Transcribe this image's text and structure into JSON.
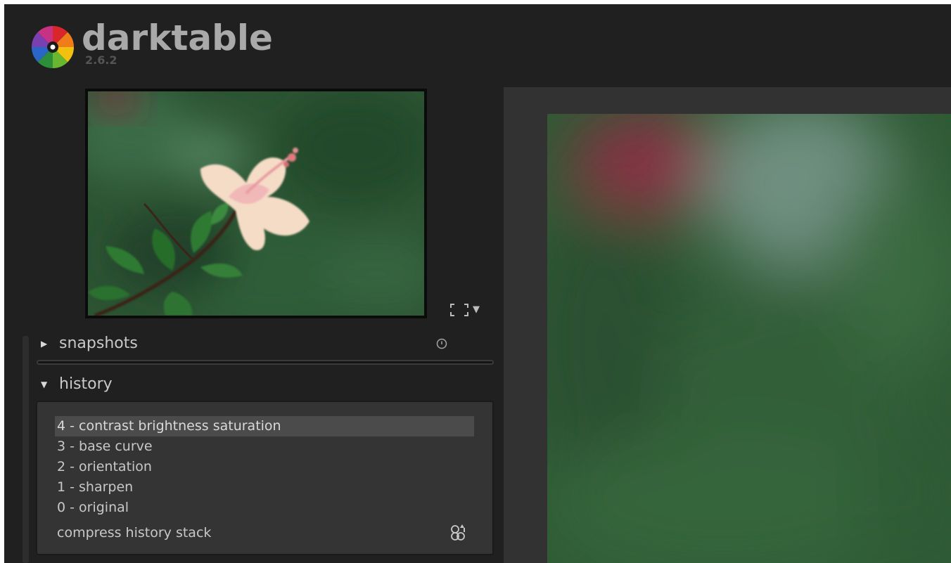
{
  "header": {
    "app_name": "darktable",
    "version": "2.6.2"
  },
  "navigation": {
    "thumbnail_icon": "hibiscus-flower-image",
    "fit_icon": "fit-to-screen-icon",
    "zoom_caret": "▼"
  },
  "snapshots": {
    "title": "snapshots",
    "collapse_icon": "triangle-right-icon",
    "reset_icon": "reset-circle-icon"
  },
  "history": {
    "title": "history",
    "collapse_icon": "triangle-down-icon",
    "items": [
      "4 - contrast brightness saturation",
      "3 - base curve",
      "2 - orientation",
      "1 - sharpen",
      "0 - original"
    ],
    "selected_index": 0,
    "compress_label": "compress history stack",
    "compress_icon": "create-style-icon"
  },
  "colors": {
    "background": "#202020",
    "panel": "#343434",
    "selected": "#4b4b4b",
    "text": "#c8c8c8",
    "brand_text": "#a9a9a9"
  }
}
